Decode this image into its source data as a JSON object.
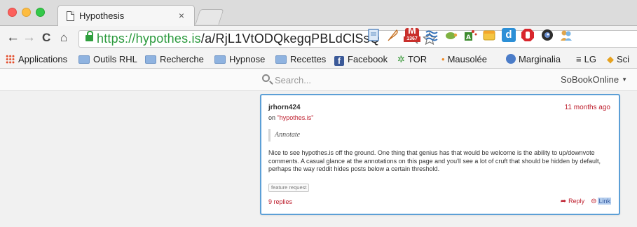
{
  "browser": {
    "tab": {
      "title": "Hypothesis",
      "close_glyph": "×"
    },
    "nav": {
      "back": "←",
      "forward": "→",
      "reload": "C",
      "home": "⌂"
    },
    "url": {
      "scheme_host": "https://hypothes.is",
      "path": "/a/RjL1VtODQkegqPBLdClSsQ"
    },
    "extension_badge": "1367",
    "bookmarks": [
      {
        "label": "Applications",
        "icon": "apps-grid-icon"
      },
      {
        "label": "Outils RHL",
        "icon": "folder-icon"
      },
      {
        "label": "Recherche",
        "icon": "folder-icon"
      },
      {
        "label": "Hypnose",
        "icon": "folder-icon"
      },
      {
        "label": "Recettes",
        "icon": "folder-icon"
      },
      {
        "label": "Facebook",
        "icon": "facebook-icon"
      },
      {
        "label": "TOR",
        "icon": "tor-icon"
      },
      {
        "label": "Mausolée",
        "icon": "flame-icon"
      },
      {
        "label": "Marginalia",
        "icon": "globe-icon"
      },
      {
        "label": "LG",
        "icon": "lg-icon"
      },
      {
        "label": "Sci",
        "icon": "sci-icon"
      }
    ]
  },
  "hypothesis": {
    "search_placeholder": "Search...",
    "user": "SoBookOnline",
    "annotation": {
      "username": "jrhorn424",
      "timestamp": "11 months ago",
      "on_prefix": "on",
      "document": "\"hypothes.is\"",
      "quote": "Annotate",
      "body": "Nice to see hypothes.is off the ground. One thing that genius has that would be welcome is the ability to up/downvote comments. A casual glance at the annotations on this page and you'll see a lot of cruft that should be hidden by default, perhaps the way reddit hides posts below a certain threshold.",
      "tags": [
        "feature request"
      ],
      "replies": "9 replies",
      "reply_label": "Reply",
      "link_label": "Link"
    }
  },
  "colors": {
    "accent_red": "#bd1c2b",
    "secure_green": "#2b9a3d",
    "card_border": "#5c9fd6"
  }
}
